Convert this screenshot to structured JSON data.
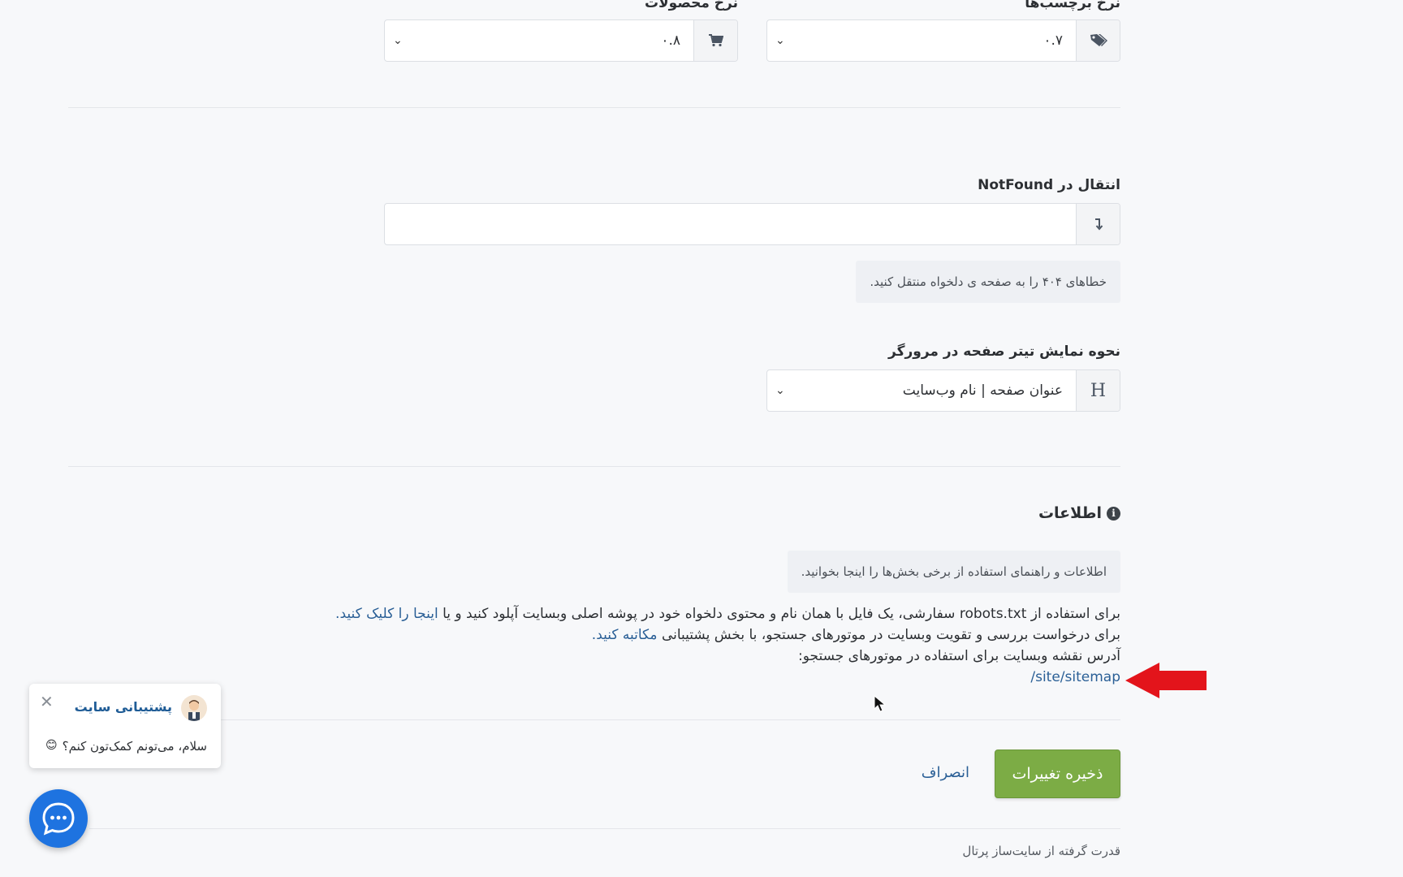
{
  "rates": {
    "tags": {
      "label": "نرخ برچسب‌ها",
      "value": "۰.۷",
      "icon": "tag-icon"
    },
    "products": {
      "label": "نرخ محصولات",
      "value": "۰.۸",
      "icon": "cart-icon"
    }
  },
  "notfound": {
    "label": "انتقال در NotFound",
    "value": "",
    "icon": "redirect-icon",
    "help": "خطاهای ۴۰۴ را به صفحه ی دلخواه منتقل کنید."
  },
  "title_display": {
    "label": "نحوه نمایش تیتر صفحه در مرورگر",
    "value": "عنوان صفحه | نام وب‌سایت",
    "icon_glyph": "H"
  },
  "info": {
    "title": "اطلاعات",
    "help": "اطلاعات و راهنمای استفاده از برخی بخش‌ها را اینجا بخوانید.",
    "line1_prefix": "برای استفاده از robots.txt سفارشی، یک فایل با همان نام و محتوی دلخواه خود در پوشه اصلی وبسایت آپلود کنید و یا",
    "line1_link": "اینجا را کلیک کنید.",
    "line2_prefix": "برای درخواست بررسی و تقویت وبسایت در موتورهای جستجو، با بخش پشتیبانی",
    "line2_link": "مکاتبه کنید.",
    "line3": "آدرس نقشه وبسایت برای استفاده در موتورهای جستجو:",
    "sitemap_link": "/site/sitemap"
  },
  "actions": {
    "save": "ذخیره تغییرات",
    "cancel": "انصراف"
  },
  "footer": "قدرت گرفته از سایت‌ساز پرتال",
  "chat": {
    "name": "پشتیبانی سایت",
    "message": "سلام، می‌تونم کمک‌تون کنم؟",
    "emoji": "😊",
    "close": "✕"
  },
  "colors": {
    "accent": "#7cac45",
    "link": "#2a5f96",
    "annotation_arrow": "#e3141b",
    "chat_bubble": "#1e73e0"
  }
}
